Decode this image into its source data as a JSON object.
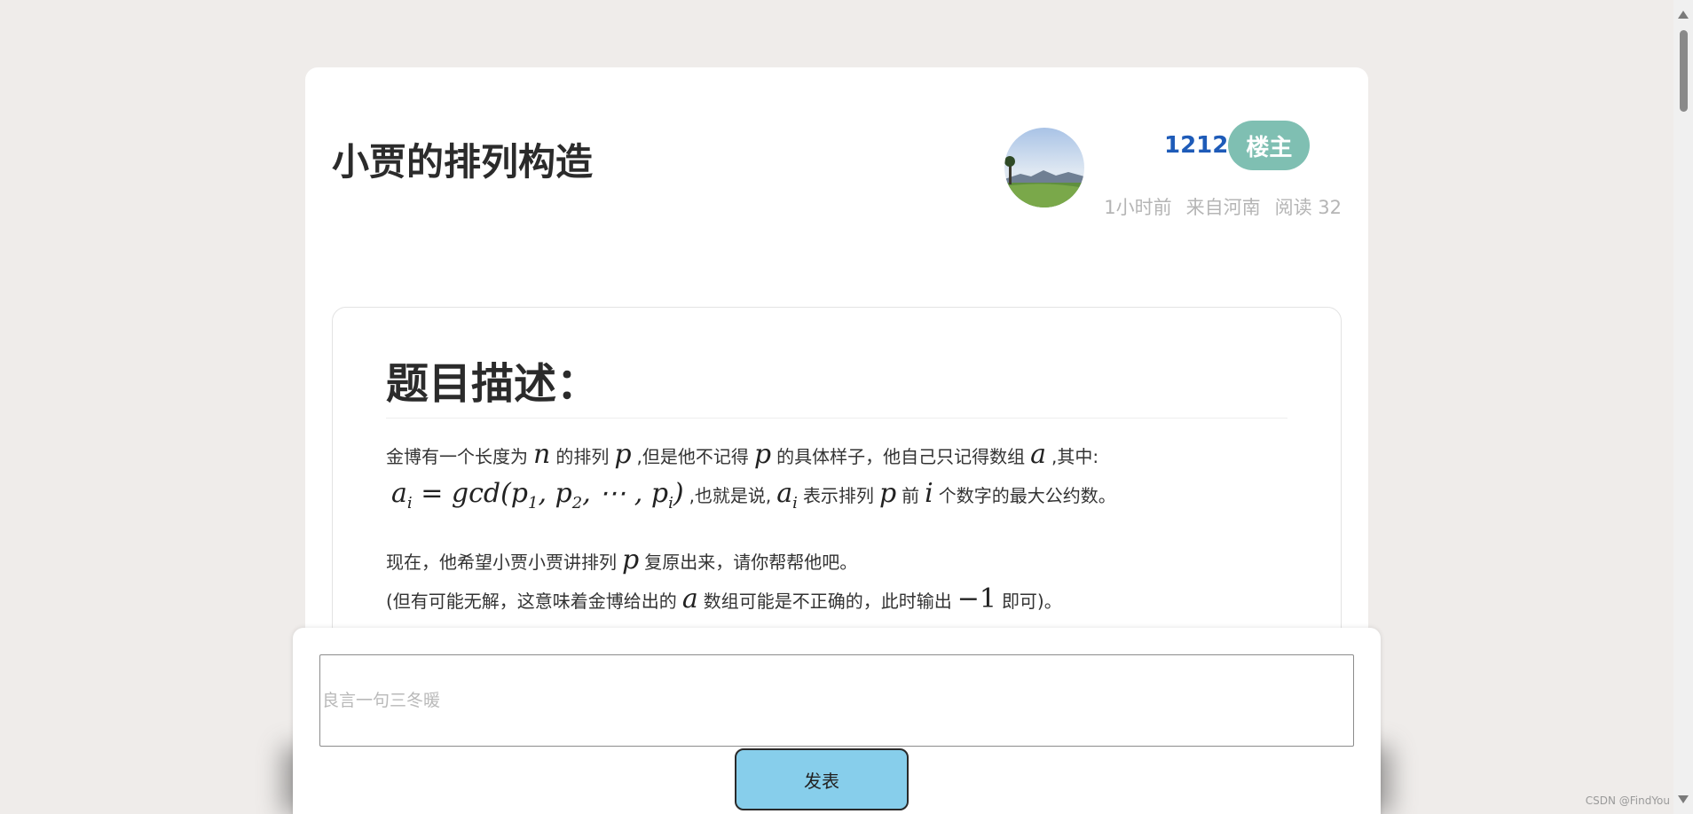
{
  "post": {
    "title": "小贾的排列构造",
    "author": "1212",
    "badge": "楼主",
    "time": "1小时前",
    "location": "来自河南",
    "reads": "阅读 32"
  },
  "content": {
    "heading": "题目描述：",
    "p1_a": "金博有一个长度为",
    "p1_n": "n",
    "p1_b": "的排列",
    "p1_p": "p",
    "p1_c": ",但是他不记得",
    "p1_p2": "p",
    "p1_d": "的具体样子，他自己只记得数组",
    "p1_arr": "a",
    "p1_e": ",其中:",
    "formula_ai": "a",
    "formula_i": "i",
    "formula_eq": "= gcd(p",
    "formula_s1": "1",
    "formula_sep1": ", p",
    "formula_s2": "2",
    "formula_sep2": ", ⋯ , p",
    "formula_si": "i",
    "formula_close": ")",
    "p1_f": ",也就是说,",
    "p1_ai2": "a",
    "p1_ai2_sub": "i",
    "p1_g": "表示排列",
    "p1_p3": "p",
    "p1_h": "前",
    "p1_i": "i",
    "p1_j": "个数字的最大公约数。",
    "p2_a": "现在，他希望小贾小贾讲排列",
    "p2_p": "p",
    "p2_b": "复原出来，请你帮帮他吧。",
    "p3_a": "(但有可能无解，这意味着金博给出的",
    "p3_arr": "a",
    "p3_b": "数组可能是不正确的，此时输出",
    "p3_val": "−1",
    "p3_c": "即可)。"
  },
  "comment": {
    "placeholder": "良言一句三冬暖",
    "value": "",
    "button": "发表"
  },
  "watermark": "CSDN @FindYou",
  "colors": {
    "page_bg": "#efecea",
    "author": "#1e5bb8",
    "badge_bg": "#7fbfb2",
    "button_bg": "#87ceeb"
  }
}
